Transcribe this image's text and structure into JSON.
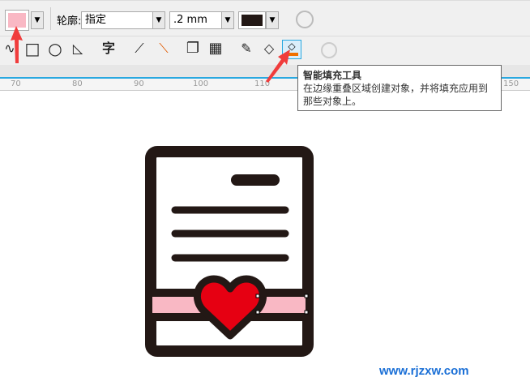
{
  "toolbar": {
    "fill_color": "#f9b8c4",
    "outline_label": "轮廓:",
    "outline_style": "指定",
    "outline_width": ".2 mm",
    "outline_color": "#231815"
  },
  "tools": [
    {
      "name": "freehand-icon",
      "glyph": "∿"
    },
    {
      "name": "rectangle-icon",
      "glyph": "□"
    },
    {
      "name": "ellipse-icon",
      "glyph": "○"
    },
    {
      "name": "shapes-icon",
      "glyph": "◺"
    },
    {
      "name": "text-icon",
      "glyph": "字"
    },
    {
      "name": "line-icon",
      "glyph": "⟋"
    },
    {
      "name": "connector-icon",
      "glyph": "⟍"
    },
    {
      "name": "drop-shadow-icon",
      "glyph": "❐"
    },
    {
      "name": "transparency-icon",
      "glyph": "▦"
    },
    {
      "name": "eyedropper-icon",
      "glyph": "✎"
    },
    {
      "name": "fill-icon",
      "glyph": "◇"
    },
    {
      "name": "smart-fill-icon",
      "glyph": "◈"
    }
  ],
  "ruler": [
    "70",
    "80",
    "90",
    "100",
    "110",
    "150"
  ],
  "tooltip": {
    "title": "智能填充工具",
    "body": "在边缘重叠区域创建对象，并将填充应用到那些对象上。"
  },
  "watermark": "www.rjzxw.com",
  "colors": {
    "dark": "#231815",
    "pink": "#f9b8c4",
    "heart": "#e60012",
    "ruler_line": "#29a8e0",
    "arrow": "#f03c3c"
  }
}
